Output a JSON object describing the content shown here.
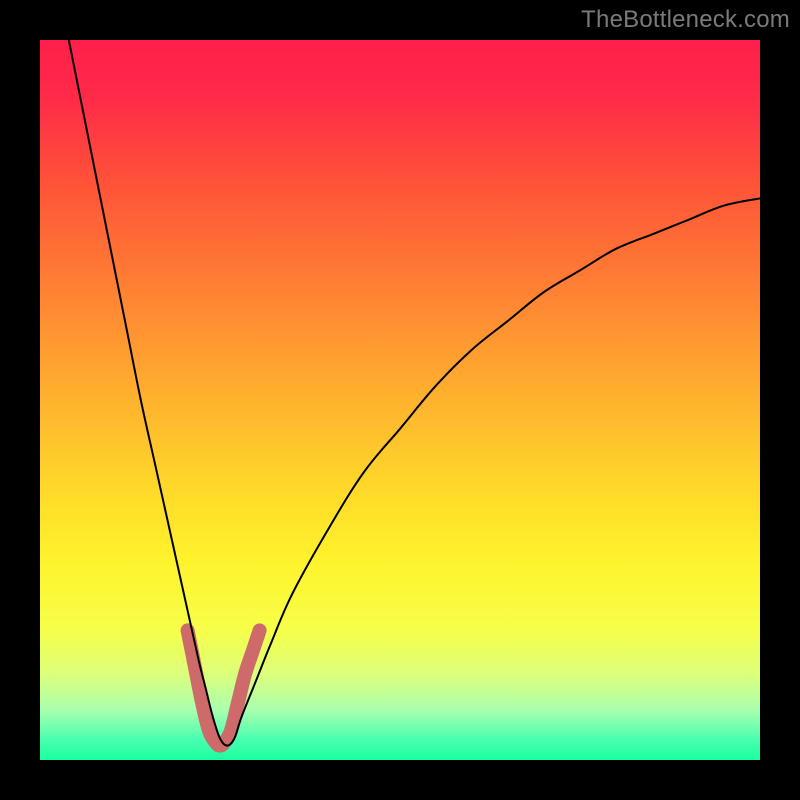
{
  "watermark": "TheBottleneck.com",
  "chart_data": {
    "type": "line",
    "title": "",
    "xlabel": "",
    "ylabel": "",
    "xlim": [
      0,
      100
    ],
    "ylim": [
      0,
      100
    ],
    "background_gradient": {
      "stops": [
        {
          "offset": 0.0,
          "color": "#ff1f4b"
        },
        {
          "offset": 0.08,
          "color": "#ff2a48"
        },
        {
          "offset": 0.2,
          "color": "#ff5338"
        },
        {
          "offset": 0.35,
          "color": "#ff8233"
        },
        {
          "offset": 0.5,
          "color": "#ffb22e"
        },
        {
          "offset": 0.62,
          "color": "#ffd82a"
        },
        {
          "offset": 0.72,
          "color": "#fff22b"
        },
        {
          "offset": 0.82,
          "color": "#f6ff4a"
        },
        {
          "offset": 0.88,
          "color": "#dcff7a"
        },
        {
          "offset": 0.93,
          "color": "#aaffad"
        },
        {
          "offset": 0.97,
          "color": "#4cffb0"
        },
        {
          "offset": 1.0,
          "color": "#1affa0"
        }
      ]
    },
    "series": [
      {
        "name": "bottleneck-curve",
        "color": "#000000",
        "stroke_width": 2,
        "x": [
          4,
          6,
          8,
          10,
          12,
          14,
          16,
          18,
          20,
          22,
          23,
          24,
          25,
          26,
          27,
          28,
          30,
          32,
          35,
          40,
          45,
          50,
          55,
          60,
          65,
          70,
          75,
          80,
          85,
          90,
          95,
          100
        ],
        "values": [
          100,
          90,
          80,
          70,
          60,
          50,
          41,
          32,
          23,
          14,
          10,
          6,
          3,
          2,
          3,
          6,
          11,
          16,
          23,
          32,
          40,
          46,
          52,
          57,
          61,
          65,
          68,
          71,
          73,
          75,
          77,
          78
        ]
      },
      {
        "name": "highlight-band",
        "color": "#cf6a6a",
        "stroke_width": 14,
        "linecap": "round",
        "x": [
          20.5,
          21.5,
          22.5,
          23.5,
          24.5,
          25.0,
          25.5,
          26.5,
          27.5,
          28.5,
          29.5,
          30.5
        ],
        "values": [
          18,
          13,
          8,
          4,
          2.3,
          2.0,
          2.3,
          4,
          8,
          12,
          15,
          18
        ]
      }
    ]
  }
}
